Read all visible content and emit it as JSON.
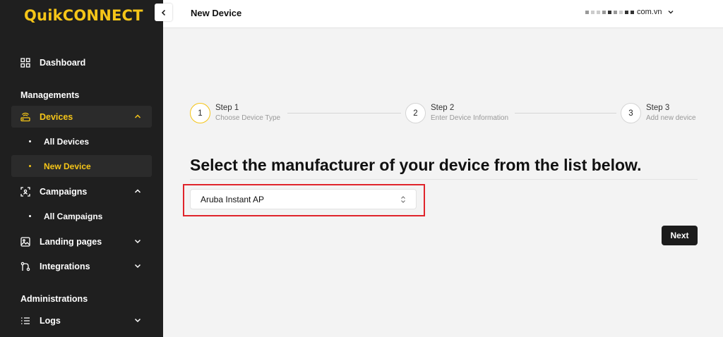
{
  "app": {
    "logo": "QuikCONNECT"
  },
  "header": {
    "title": "New Device",
    "account_domain": "com.vn"
  },
  "sidebar": {
    "dashboard": "Dashboard",
    "section_managements": "Managements",
    "devices": "Devices",
    "all_devices": "All Devices",
    "new_device": "New Device",
    "campaigns": "Campaigns",
    "all_campaigns": "All Campaigns",
    "landing_pages": "Landing pages",
    "integrations": "Integrations",
    "section_administrations": "Administrations",
    "logs": "Logs"
  },
  "stepper": {
    "steps": [
      {
        "number": "1",
        "title": "Step 1",
        "subtitle": "Choose Device Type"
      },
      {
        "number": "2",
        "title": "Step 2",
        "subtitle": "Enter Device Information"
      },
      {
        "number": "3",
        "title": "Step 3",
        "subtitle": "Add new device"
      }
    ]
  },
  "main": {
    "heading": "Select the manufacturer of your device from the list below.",
    "manufacturer_select": {
      "value": "Aruba Instant AP"
    },
    "next_label": "Next"
  },
  "colors": {
    "accent": "#f5c518",
    "sidebar_bg": "#1f1f1f",
    "highlight_border": "#e0242b"
  }
}
